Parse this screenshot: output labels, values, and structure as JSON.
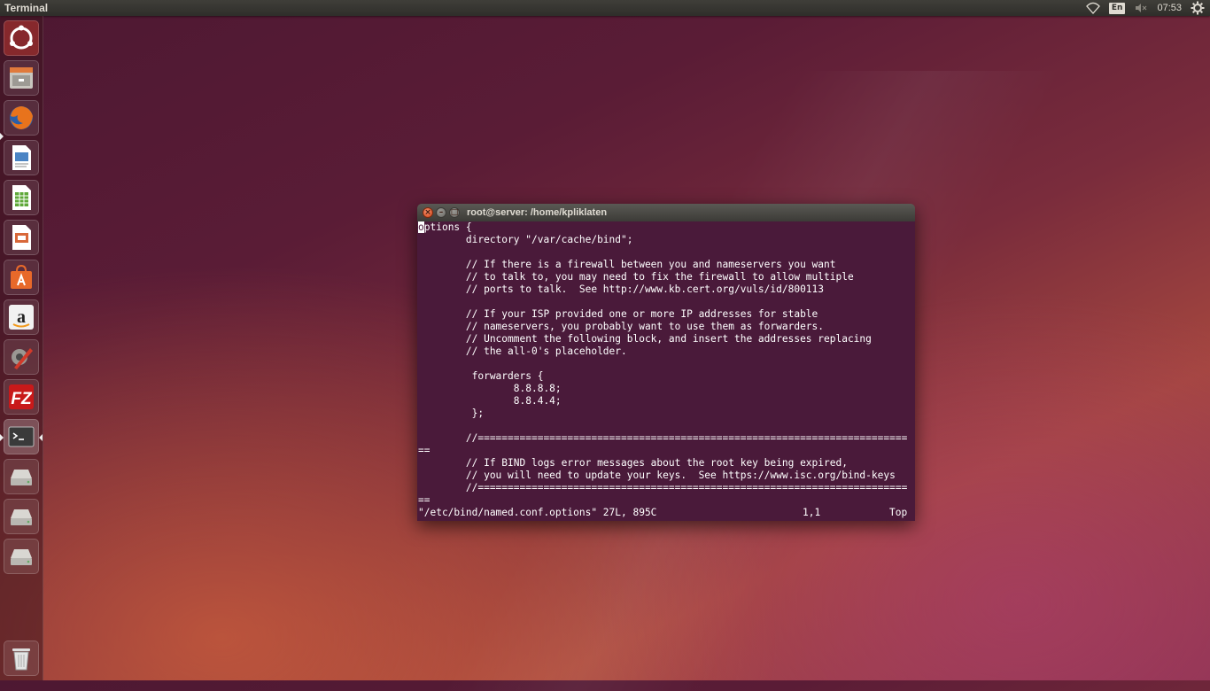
{
  "top_panel": {
    "app_title": "Terminal",
    "keyboard_layout": "En",
    "clock": "07:53",
    "icons": [
      "wifi-icon",
      "volume-muted-icon",
      "gear-icon"
    ]
  },
  "launcher": {
    "items": [
      {
        "name": "dash-home",
        "icon": "ubuntu-logo-icon"
      },
      {
        "name": "files",
        "icon": "file-cabinet-icon"
      },
      {
        "name": "firefox",
        "icon": "firefox-icon"
      },
      {
        "name": "writer",
        "icon": "libreoffice-writer-icon"
      },
      {
        "name": "calc",
        "icon": "libreoffice-calc-icon"
      },
      {
        "name": "impress",
        "icon": "libreoffice-impress-icon"
      },
      {
        "name": "software-center",
        "icon": "shopping-bag-icon"
      },
      {
        "name": "amazon",
        "icon": "amazon-icon"
      },
      {
        "name": "system-settings",
        "icon": "settings-wrench-icon"
      },
      {
        "name": "filezilla",
        "icon": "filezilla-icon"
      },
      {
        "name": "terminal",
        "icon": "terminal-icon"
      },
      {
        "name": "drive-1",
        "icon": "hard-drive-icon"
      },
      {
        "name": "drive-2",
        "icon": "hard-drive-icon"
      },
      {
        "name": "drive-3",
        "icon": "hard-drive-icon"
      },
      {
        "name": "trash",
        "icon": "trash-icon"
      }
    ]
  },
  "terminal": {
    "title": "root@server: /home/kpliklaten",
    "cursor_char": "o",
    "first_line_rest": "ptions {",
    "lines": [
      "        directory \"/var/cache/bind\";",
      "",
      "        // If there is a firewall between you and nameservers you want",
      "        // to talk to, you may need to fix the firewall to allow multiple",
      "        // ports to talk.  See http://www.kb.cert.org/vuls/id/800113",
      "",
      "        // If your ISP provided one or more IP addresses for stable",
      "        // nameservers, you probably want to use them as forwarders.",
      "        // Uncomment the following block, and insert the addresses replacing",
      "        // the all-0's placeholder.",
      "",
      "         forwarders {",
      "                8.8.8.8;",
      "                8.8.4.4;",
      "         };",
      "",
      "        //========================================================================",
      "==",
      "        // If BIND logs error messages about the root key being expired,",
      "        // you will need to update your keys.  See https://www.isc.org/bind-keys",
      "        //========================================================================",
      "=="
    ],
    "status": {
      "file_info": "\"/etc/bind/named.conf.options\" 27L, 895C",
      "position": "1,1",
      "scroll": "Top"
    }
  }
}
